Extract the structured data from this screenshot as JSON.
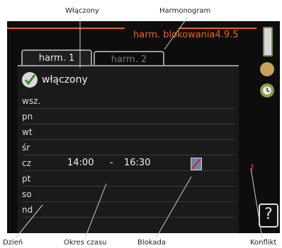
{
  "callouts": {
    "top_left": "Włączony",
    "top_right": "Harmonogram",
    "bottom_day": "Dzień",
    "bottom_period": "Okres czasu",
    "bottom_lock": "Blokada",
    "bottom_conflict": "Konflikt"
  },
  "screen": {
    "title": "harm. blokowania4.9.5",
    "tabs": [
      {
        "label": "harm. 1",
        "active": true
      },
      {
        "label": "harm. 2",
        "active": false
      }
    ],
    "enabled_label": "włączony",
    "days": [
      "wsz.",
      "pn",
      "wt",
      "śr",
      "cz",
      "pt",
      "so",
      "nd"
    ],
    "schedule": {
      "day": "cz",
      "start": "14:00",
      "separator": "-",
      "end": "16:30"
    },
    "conflict_marker": "!",
    "help": "?"
  },
  "colors": {
    "accent": "#e7641c",
    "conflict": "#e01818"
  },
  "icons": [
    "check-icon",
    "lock-icon",
    "thermometer-icon",
    "gear-icon",
    "clock-icon",
    "help-icon"
  ]
}
